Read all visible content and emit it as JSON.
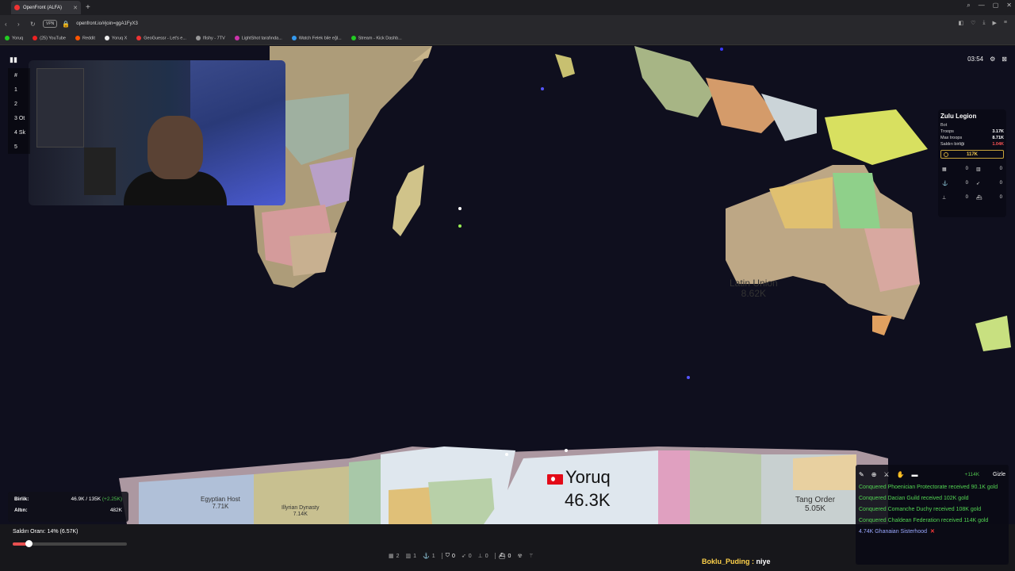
{
  "browser": {
    "tab_title": "OpenFront (ALFA)",
    "url": "openfront.io/#join=ggA1FyX3",
    "vpn_label": "VPN",
    "bookmarks": [
      "Yoruq",
      "(25) YouTube",
      "Reddit",
      "Yoruq X",
      "GeoGuessr - Let's e...",
      "Ifishy - 7TV",
      "LightShot tarafında...",
      "Watch Felek bile eğl...",
      "Stream - Kick Dashb..."
    ]
  },
  "game": {
    "timer": "03:54",
    "left_panel": [
      "#",
      "1",
      "2",
      "3 Ot",
      "4 Sk",
      "5"
    ],
    "player_panel": {
      "name": "Zulu Legion",
      "type": "Bot",
      "troops_label": "Troops",
      "troops": "3.17K",
      "max_troops_label": "Max troops",
      "max_troops": "8.71K",
      "attack_label": "Saldırı birliği",
      "attack": "1.04K",
      "gold": "117K",
      "buildings": [
        "0",
        "0",
        "0",
        "0",
        "0",
        "0"
      ]
    },
    "stats": {
      "troops_label": "Birlik:",
      "troops": "46.9K / 135K",
      "troops_delta": "(+2.25K)",
      "gold_label": "Altın:",
      "gold": "482K"
    },
    "attack_ratio": {
      "label": "Saldırı Oranı: 14% (6.57K)",
      "value": 0.14
    },
    "build_bar": [
      "2",
      "1",
      "1",
      "0",
      "0",
      "0",
      "0"
    ],
    "map_labels": {
      "player_name": "Yoruq",
      "player_troops": "46.3K",
      "latin": "Latin Union",
      "latin_troops": "8.62K",
      "tang": "Tang Order",
      "tang_troops": "5.05K",
      "egyptian": "Egyptian Host",
      "egyptian_troops": "7.71K",
      "illyrian": "Illyrian Dynasty",
      "illyrian_troops": "7.14K"
    },
    "events": {
      "gold_gain": "+114K",
      "hide": "Gizle",
      "items": [
        "Conquered Phoenician Protectorate received 90.1K gold",
        "Conquered Dacian Guild received 102K gold",
        "Conquered Comanche Duchy received 108K gold",
        "Conquered Chaldean Federation received 114K gold"
      ],
      "last": "4.74K Ghanaian Sisterhood"
    },
    "chat": {
      "user": "Boklu_Puding",
      "message": "niye"
    }
  },
  "colors": {
    "ocean": "#0f0f1e",
    "player_land": "#dfe7ee",
    "gold": "#f0c850",
    "green": "#52d452",
    "red": "#e85050"
  }
}
